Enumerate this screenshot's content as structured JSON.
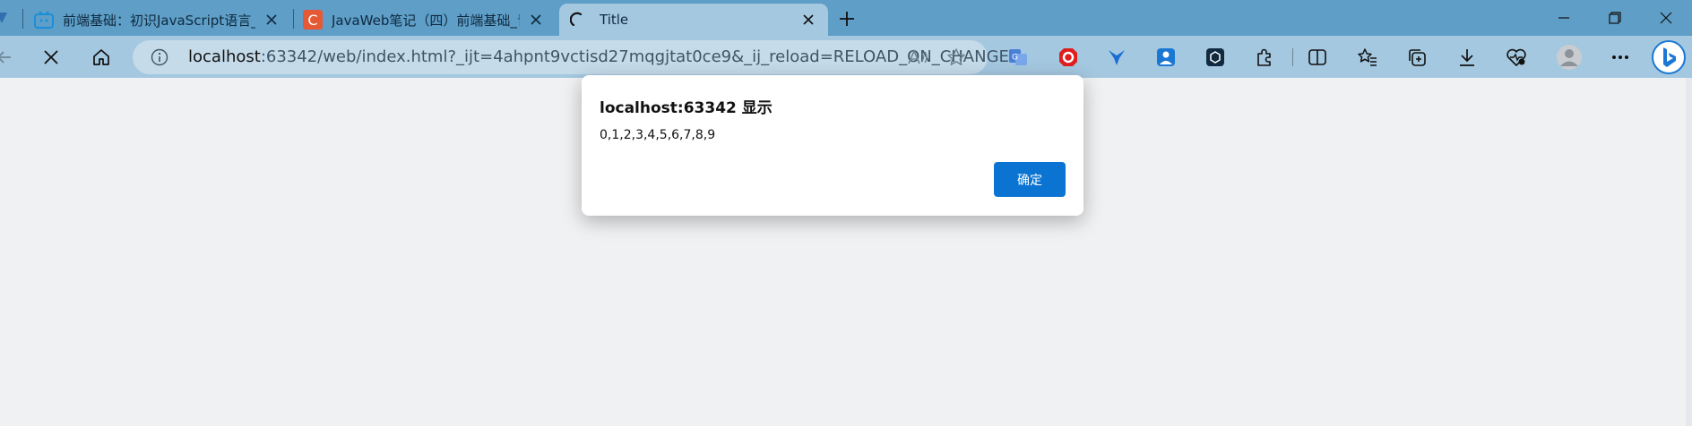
{
  "tabs": [
    {
      "title": "前端基础：初识JavaScript语言_哔",
      "icon": "bilibili-icon"
    },
    {
      "title": "JavaWeb笔记（四）前端基础_青",
      "icon": "csdn-icon"
    },
    {
      "title": "Title",
      "icon": "loading-spinner-icon",
      "active": true
    }
  ],
  "address": {
    "host": "localhost",
    "rest": ":63342/web/index.html?_ijt=4ahpnt9vctisd27mqgjtat0ce9&_ij_reload=RELOAD_ON_CHANGE"
  },
  "dialog": {
    "title": "localhost:63342 显示",
    "message": "0,1,2,3,4,5,6,7,8,9",
    "ok_label": "确定"
  },
  "colors": {
    "tabbar": "#5e9ec7",
    "toolbar": "#a4c8e0",
    "accent": "#0b74d2"
  }
}
